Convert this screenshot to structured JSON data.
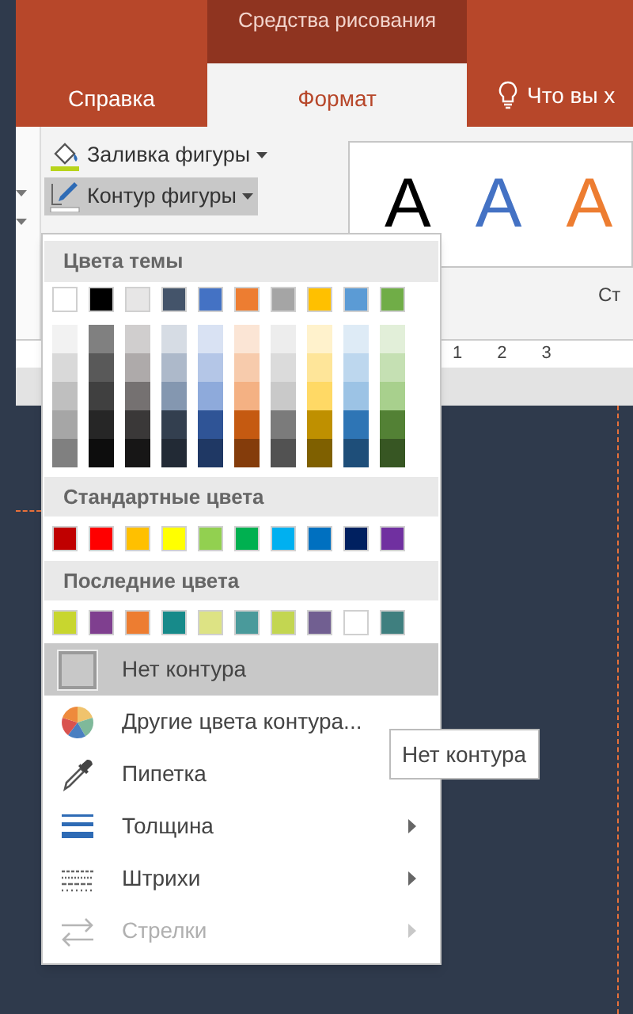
{
  "ribbon": {
    "context_title": "Средства рисования",
    "tabs": [
      {
        "label": "Справка",
        "selected": false,
        "kind": "tab"
      },
      {
        "label": "Формат",
        "selected": true,
        "kind": "tab"
      },
      {
        "label": "Что вы х",
        "selected": false,
        "kind": "search"
      }
    ],
    "buttons": [
      {
        "label": "Заливка фигуры",
        "expanded": false,
        "kind": "fill"
      },
      {
        "label": "Контур фигуры",
        "expanded": true,
        "kind": "outline"
      }
    ],
    "gallery": [
      {
        "label": "A",
        "color": "#000000"
      },
      {
        "label": "A",
        "color": "#4472c4"
      },
      {
        "label": "A",
        "color": "#ed7d31"
      }
    ],
    "group_label": "Ст",
    "ruler": [
      "1",
      "2",
      "3"
    ]
  },
  "menu": {
    "theme_header": "Цвета темы",
    "theme_top": [
      {
        "color": "#ffffff"
      },
      {
        "color": "#000000"
      },
      {
        "color": "#e7e6e6"
      },
      {
        "color": "#44546a"
      },
      {
        "color": "#4472c4"
      },
      {
        "color": "#ed7d31"
      },
      {
        "color": "#a5a5a5"
      },
      {
        "color": "#ffc000"
      },
      {
        "color": "#5b9bd5"
      },
      {
        "color": "#70ad47"
      }
    ],
    "theme_shades": [
      [
        {
          "color": "#f2f2f2"
        },
        {
          "color": "#d9d9d9"
        },
        {
          "color": "#bfbfbf"
        },
        {
          "color": "#a6a6a6"
        },
        {
          "color": "#808080"
        }
      ],
      [
        {
          "color": "#808080"
        },
        {
          "color": "#595959"
        },
        {
          "color": "#404040"
        },
        {
          "color": "#262626"
        },
        {
          "color": "#0d0d0d"
        }
      ],
      [
        {
          "color": "#d0cece"
        },
        {
          "color": "#aeaaaa"
        },
        {
          "color": "#757171"
        },
        {
          "color": "#3a3838"
        },
        {
          "color": "#171616"
        }
      ],
      [
        {
          "color": "#d6dce4"
        },
        {
          "color": "#adb9ca"
        },
        {
          "color": "#8497b0"
        },
        {
          "color": "#333f4f"
        },
        {
          "color": "#222a35"
        }
      ],
      [
        {
          "color": "#d9e2f3"
        },
        {
          "color": "#b4c6e7"
        },
        {
          "color": "#8eaadb"
        },
        {
          "color": "#2f5496"
        },
        {
          "color": "#1f3864"
        }
      ],
      [
        {
          "color": "#fbe5d5"
        },
        {
          "color": "#f7cbac"
        },
        {
          "color": "#f4b183"
        },
        {
          "color": "#c55a11"
        },
        {
          "color": "#843c0b"
        }
      ],
      [
        {
          "color": "#ededed"
        },
        {
          "color": "#dbdbdb"
        },
        {
          "color": "#c9c9c9"
        },
        {
          "color": "#7b7b7b"
        },
        {
          "color": "#525252"
        }
      ],
      [
        {
          "color": "#fff2cc"
        },
        {
          "color": "#fee599"
        },
        {
          "color": "#ffd965"
        },
        {
          "color": "#bf9000"
        },
        {
          "color": "#7f6000"
        }
      ],
      [
        {
          "color": "#deebf6"
        },
        {
          "color": "#bdd7ee"
        },
        {
          "color": "#9cc3e5"
        },
        {
          "color": "#2e75b5"
        },
        {
          "color": "#1e4e79"
        }
      ],
      [
        {
          "color": "#e2efd9"
        },
        {
          "color": "#c5e0b3"
        },
        {
          "color": "#a8d08d"
        },
        {
          "color": "#538135"
        },
        {
          "color": "#375623"
        }
      ]
    ],
    "standard_header": "Стандартные цвета",
    "standard": [
      {
        "color": "#c00000"
      },
      {
        "color": "#ff0000"
      },
      {
        "color": "#ffc000"
      },
      {
        "color": "#ffff00"
      },
      {
        "color": "#92d050"
      },
      {
        "color": "#00b050"
      },
      {
        "color": "#00b0f0"
      },
      {
        "color": "#0070c0"
      },
      {
        "color": "#002060"
      },
      {
        "color": "#7030a0"
      }
    ],
    "recent_header": "Последние цвета",
    "recent": [
      {
        "color": "#c8d62f"
      },
      {
        "color": "#7f3f8f"
      },
      {
        "color": "#ed7d31"
      },
      {
        "color": "#178a8a"
      },
      {
        "color": "#dde384"
      },
      {
        "color": "#4a9a9b"
      },
      {
        "color": "#c3d651"
      },
      {
        "color": "#715f91"
      },
      {
        "color": "#ffffff"
      },
      {
        "color": "#3f7f7f"
      }
    ],
    "items": [
      {
        "label": "Нет контура",
        "kind": "none",
        "selected": true,
        "disabled": false,
        "submenu": false
      },
      {
        "label": "Другие цвета контура...",
        "kind": "more",
        "selected": false,
        "disabled": false,
        "submenu": false
      },
      {
        "label": "Пипетка",
        "kind": "eyedropper",
        "selected": false,
        "disabled": false,
        "submenu": false
      },
      {
        "label": "Толщина",
        "kind": "weight",
        "selected": false,
        "disabled": false,
        "submenu": true
      },
      {
        "label": "Штрихи",
        "kind": "dashes",
        "selected": false,
        "disabled": false,
        "submenu": true
      },
      {
        "label": "Стрелки",
        "kind": "arrows",
        "selected": false,
        "disabled": true,
        "submenu": true
      }
    ]
  },
  "tooltip": "Нет контура"
}
